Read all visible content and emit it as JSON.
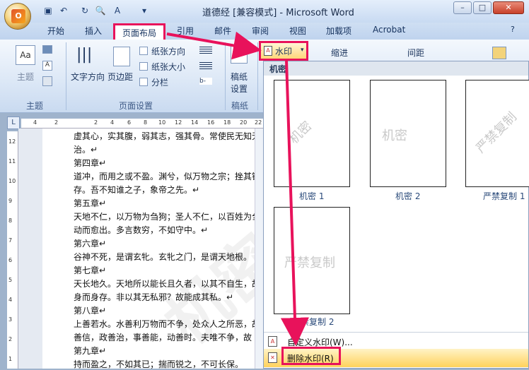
{
  "window": {
    "title": "道德经 [兼容模式] - Microsoft Word",
    "minimize": "–",
    "maximize": "□",
    "close": "✕"
  },
  "office_button": {
    "logo": "O"
  },
  "quick_access": [
    "save-icon",
    "undo-icon",
    "redo-icon",
    "print-preview-icon",
    "spelling-icon",
    "customize-icon"
  ],
  "tabs": [
    "开始",
    "插入",
    "页面布局",
    "引用",
    "邮件",
    "审阅",
    "视图",
    "加载项",
    "Acrobat"
  ],
  "active_tab": "页面布局",
  "ribbon": {
    "theme_group": {
      "label": "主题",
      "button": "主题"
    },
    "page_setup": {
      "label": "页面设置",
      "text_direction": "文字方向",
      "margins": "页边距",
      "orientation": "纸张方向",
      "size": "纸张大小",
      "columns": "分栏"
    },
    "draft": {
      "label": "稿纸",
      "button_line1": "稿纸",
      "button_line2": "设置"
    },
    "watermark_button": "水印",
    "indent": "缩进",
    "spacing": "间距"
  },
  "ruler": {
    "corner": "L",
    "h_ticks": [
      "4",
      "2",
      "2",
      "4",
      "6",
      "8",
      "10",
      "12",
      "14",
      "16",
      "18",
      "20",
      "22"
    ],
    "v_ticks": [
      "12",
      "11",
      "10",
      "9",
      "8",
      "7",
      "6",
      "5",
      "4",
      "3",
      "2",
      "1"
    ]
  },
  "document": {
    "lines": [
      "虚其心，实其腹，弱其志，强其骨。常使民无知无",
      "治。↵",
      "第四章↵",
      "道冲，而用之或不盈。渊兮，似万物之宗；挫其锐",
      "存。吾不知谁之子，象帝之先。↵",
      "第五章↵",
      "天地不仁，以万物为刍狗；圣人不仁，以百姓为刍",
      "动而愈出。多言数穷，不如守中。↵",
      "第六章↵",
      "谷神不死，是谓玄牝。玄牝之门，是谓天地根。",
      "第七章↵",
      "天长地久。天地所以能长且久者，以其不自生，故",
      "身而身存。非以其无私邪？故能成其私。↵",
      "第八章↵",
      "上善若水。水善利万物而不争，处众人之所恶，故",
      "善信，政善治，事善能，动善时。夫唯不争，故",
      "第九章↵",
      "持而盈之，不如其已；揣而锐之，不可长保。"
    ]
  },
  "watermark_gallery": {
    "section": "机密",
    "items": [
      {
        "caption": "机密 1",
        "text": "机密"
      },
      {
        "caption": "机密 2",
        "text": "机密"
      },
      {
        "caption": "严禁复制 1",
        "text": "严禁复制"
      },
      {
        "caption": "严禁复制 2",
        "text": "严禁复制"
      }
    ]
  },
  "menu": {
    "custom": "自定义水印(W)...",
    "remove": "删除水印(R)"
  },
  "colors": {
    "highlight_box": "#e8125b",
    "arrow": "#e8125b"
  }
}
